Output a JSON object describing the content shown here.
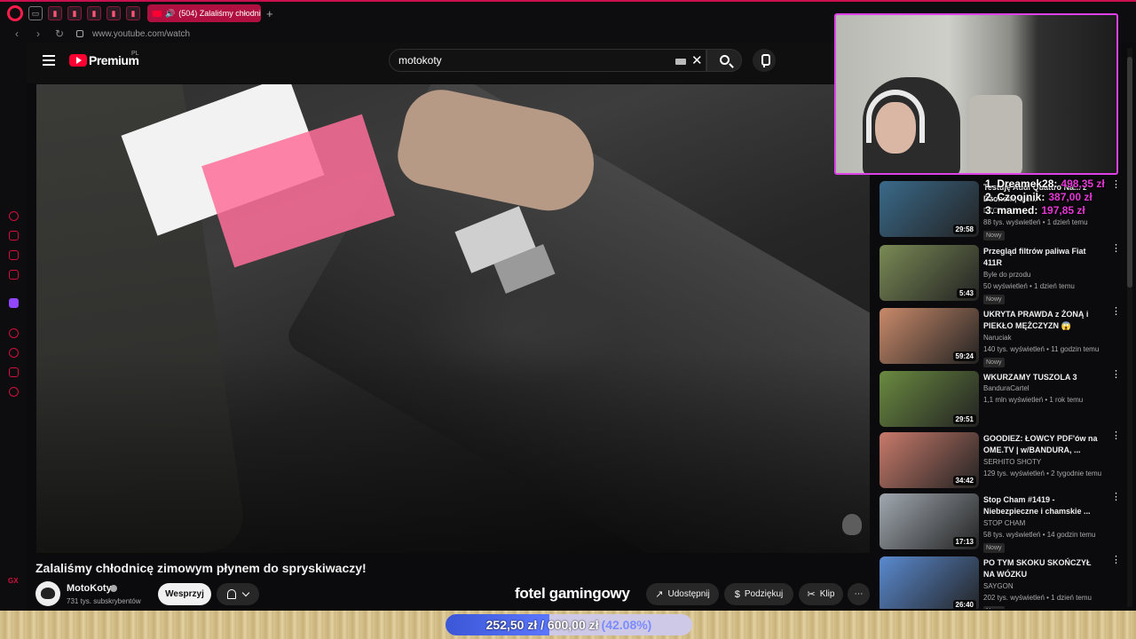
{
  "browser": {
    "active_tab_title": "(504) Zalaliśmy chłodni",
    "new_tab": "+",
    "url": "www.youtube.com/watch"
  },
  "youtube": {
    "brand": "Premium",
    "region": "PL",
    "search_value": "motokoty",
    "video": {
      "title": "Zalaliśmy chłodnicę zimowym płynem do spryskiwaczy!",
      "channel": "MotoKoty",
      "subscribers": "731 tys. subskrybentów",
      "support_label": "Wesprzyj",
      "share_label": "Udostępnij",
      "thanks_label": "Podziękuj",
      "clip_label": "Klip"
    },
    "recommendations": [
      {
        "title": "Testuję Audi Quattro Na... z Dżonem, ale...",
        "channel": "DŻONY",
        "meta": "88 tys. wyświetleń • 1 dzień temu",
        "badge": "Nowy",
        "duration": "29:58",
        "thumb_color": "#3a6a8a"
      },
      {
        "title": "Przegląd filtrów paliwa Fiat 411R",
        "channel": "Byle do przodu",
        "meta": "50 wyświetleń • 1 dzień temu",
        "badge": "Nowy",
        "duration": "5:43",
        "thumb_color": "#7a8a55"
      },
      {
        "title": "UKRYTA PRAWDA z ŻONĄ i PIEKŁO MĘŻCZYZN 😱",
        "channel": "Naruciak",
        "meta": "140 tys. wyświetleń • 11 godzin temu",
        "badge": "Nowy",
        "duration": "59:24",
        "thumb_color": "#c98a6a"
      },
      {
        "title": "WKURZAMY TUSZOLA 3",
        "channel": "BanduraCartel",
        "meta": "1,1 mln wyświetleń • 1 rok temu",
        "badge": "",
        "duration": "29:51",
        "thumb_color": "#6a8a40"
      },
      {
        "title": "GOODIEZ: ŁOWCY PDF'ów na OME.TV | w/BANDURA, ...",
        "channel": "SERHITO SHOTY",
        "meta": "129 tys. wyświetleń • 2 tygodnie temu",
        "badge": "",
        "duration": "34:42",
        "thumb_color": "#c87a6a"
      },
      {
        "title": "Stop Cham #1419 - Niebezpieczne i chamskie ...",
        "channel": "STOP CHAM",
        "meta": "58 tys. wyświetleń • 14 godzin temu",
        "badge": "Nowy",
        "duration": "17:13",
        "thumb_color": "#a0a8b0"
      },
      {
        "title": "PO TYM SKOKU SKOŃCZYŁ NA WÓZKU",
        "channel": "SAYGON",
        "meta": "202 tys. wyświetleń • 1 dzień temu",
        "badge": "Nowy",
        "duration": "26:40",
        "thumb_color": "#5a8ad0"
      }
    ]
  },
  "stream_overlay": {
    "brand": "fotel gamingowy",
    "leaderboard": [
      {
        "rank_name": "1. Dreamek28:",
        "amount": "498,35 zł"
      },
      {
        "rank_name": "2. Czoojnik:",
        "amount": "387,00 zł"
      },
      {
        "rank_name": "3. mamed:",
        "amount": "197,85 zł"
      }
    ],
    "goal": {
      "current": "252,50 zł",
      "separator": "/",
      "total": "600,00 zł",
      "percent_label": "(42.08%)",
      "fraction": 0.4208
    }
  },
  "colors": {
    "accent": "#ff0033",
    "opera_red": "#d0103e",
    "webcam_border": "#e040e8",
    "leaderboard_amount": "#e838d8",
    "goal_fill": "#3b57d6"
  }
}
